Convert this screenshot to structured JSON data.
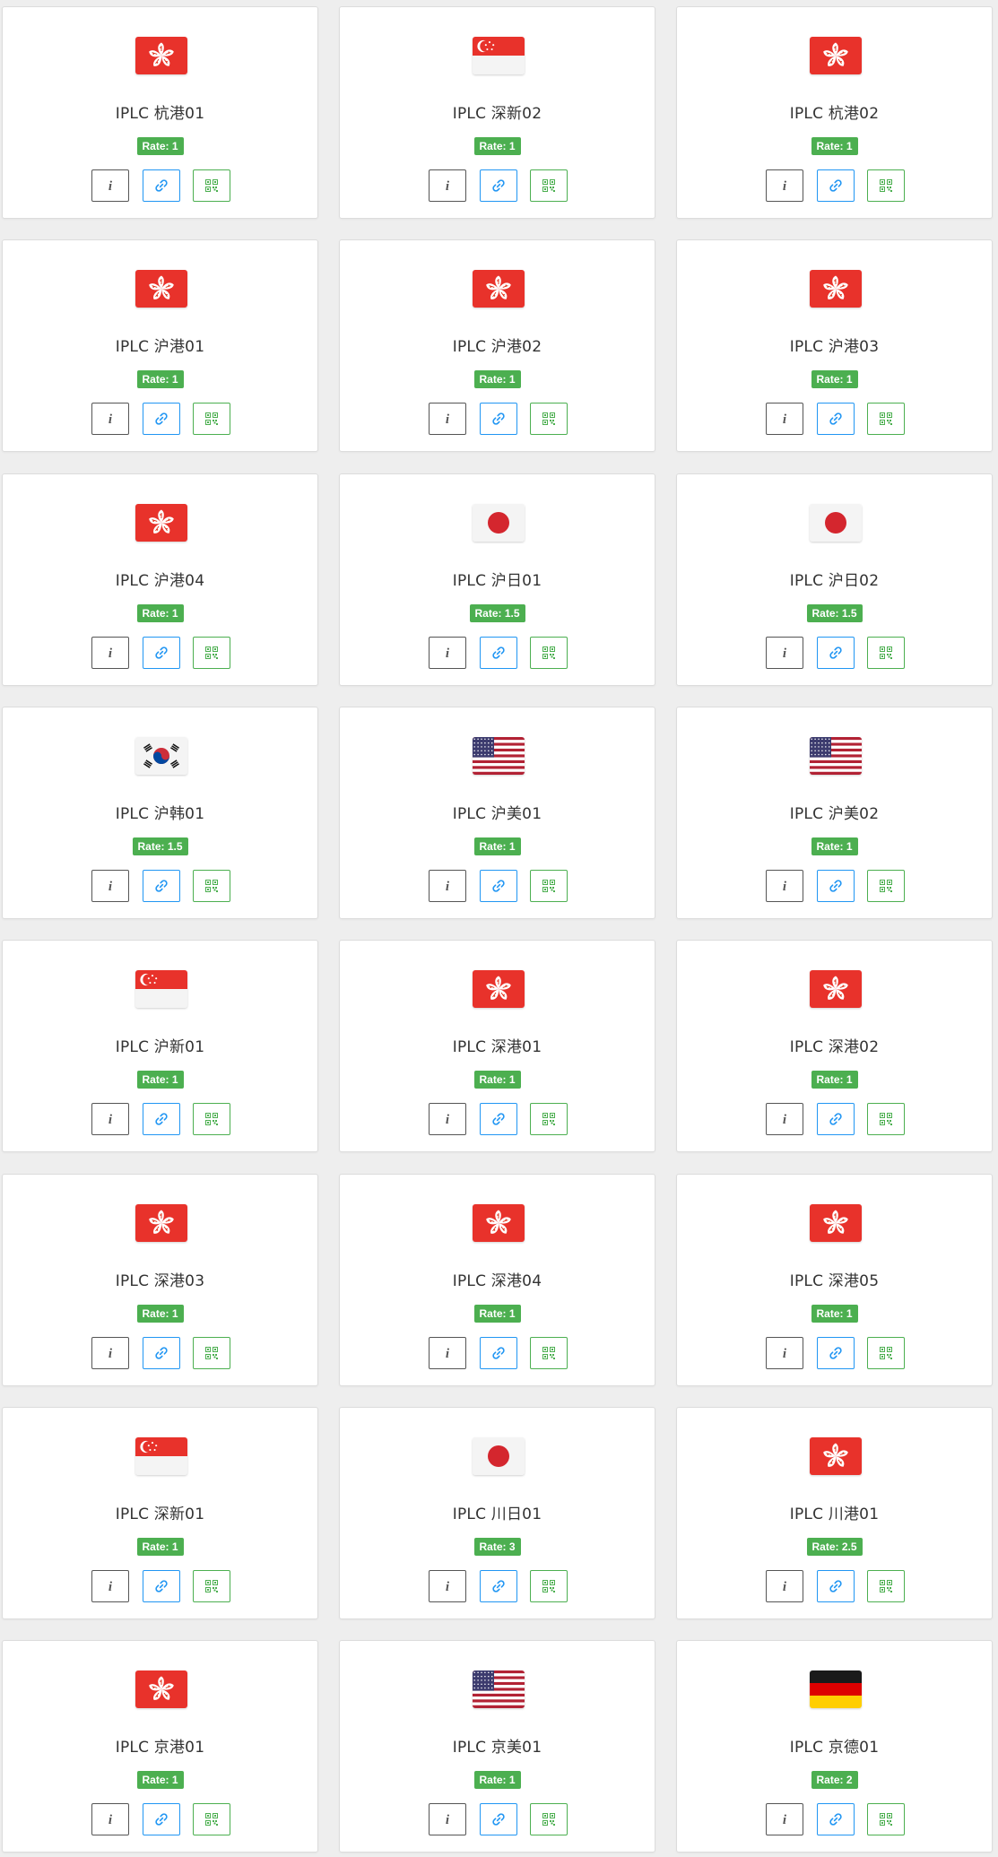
{
  "colors": {
    "rate_badge": "#4caf50",
    "info_button_border": "#555555",
    "link_button_border": "#2196f3",
    "qr_button_border": "#4caf50"
  },
  "buttons": {
    "info_icon": "info-icon",
    "link_icon": "link-icon",
    "qr_icon": "qrcode-icon"
  },
  "nodes": [
    {
      "name": "IPLC 杭港01",
      "rate": "Rate: 1",
      "flag": "hk"
    },
    {
      "name": "IPLC 深新02",
      "rate": "Rate: 1",
      "flag": "sg"
    },
    {
      "name": "IPLC 杭港02",
      "rate": "Rate: 1",
      "flag": "hk"
    },
    {
      "name": "IPLC 沪港01",
      "rate": "Rate: 1",
      "flag": "hk"
    },
    {
      "name": "IPLC 沪港02",
      "rate": "Rate: 1",
      "flag": "hk"
    },
    {
      "name": "IPLC 沪港03",
      "rate": "Rate: 1",
      "flag": "hk"
    },
    {
      "name": "IPLC 沪港04",
      "rate": "Rate: 1",
      "flag": "hk"
    },
    {
      "name": "IPLC 沪日01",
      "rate": "Rate: 1.5",
      "flag": "jp"
    },
    {
      "name": "IPLC 沪日02",
      "rate": "Rate: 1.5",
      "flag": "jp"
    },
    {
      "name": "IPLC 沪韩01",
      "rate": "Rate: 1.5",
      "flag": "kr"
    },
    {
      "name": "IPLC 沪美01",
      "rate": "Rate: 1",
      "flag": "us"
    },
    {
      "name": "IPLC 沪美02",
      "rate": "Rate: 1",
      "flag": "us"
    },
    {
      "name": "IPLC 沪新01",
      "rate": "Rate: 1",
      "flag": "sg"
    },
    {
      "name": "IPLC 深港01",
      "rate": "Rate: 1",
      "flag": "hk"
    },
    {
      "name": "IPLC 深港02",
      "rate": "Rate: 1",
      "flag": "hk"
    },
    {
      "name": "IPLC 深港03",
      "rate": "Rate: 1",
      "flag": "hk"
    },
    {
      "name": "IPLC 深港04",
      "rate": "Rate: 1",
      "flag": "hk"
    },
    {
      "name": "IPLC 深港05",
      "rate": "Rate: 1",
      "flag": "hk"
    },
    {
      "name": "IPLC 深新01",
      "rate": "Rate: 1",
      "flag": "sg"
    },
    {
      "name": "IPLC 川日01",
      "rate": "Rate: 3",
      "flag": "jp"
    },
    {
      "name": "IPLC 川港01",
      "rate": "Rate: 2.5",
      "flag": "hk"
    },
    {
      "name": "IPLC 京港01",
      "rate": "Rate: 1",
      "flag": "hk"
    },
    {
      "name": "IPLC 京美01",
      "rate": "Rate: 1",
      "flag": "us"
    },
    {
      "name": "IPLC 京德01",
      "rate": "Rate: 2",
      "flag": "de"
    }
  ]
}
